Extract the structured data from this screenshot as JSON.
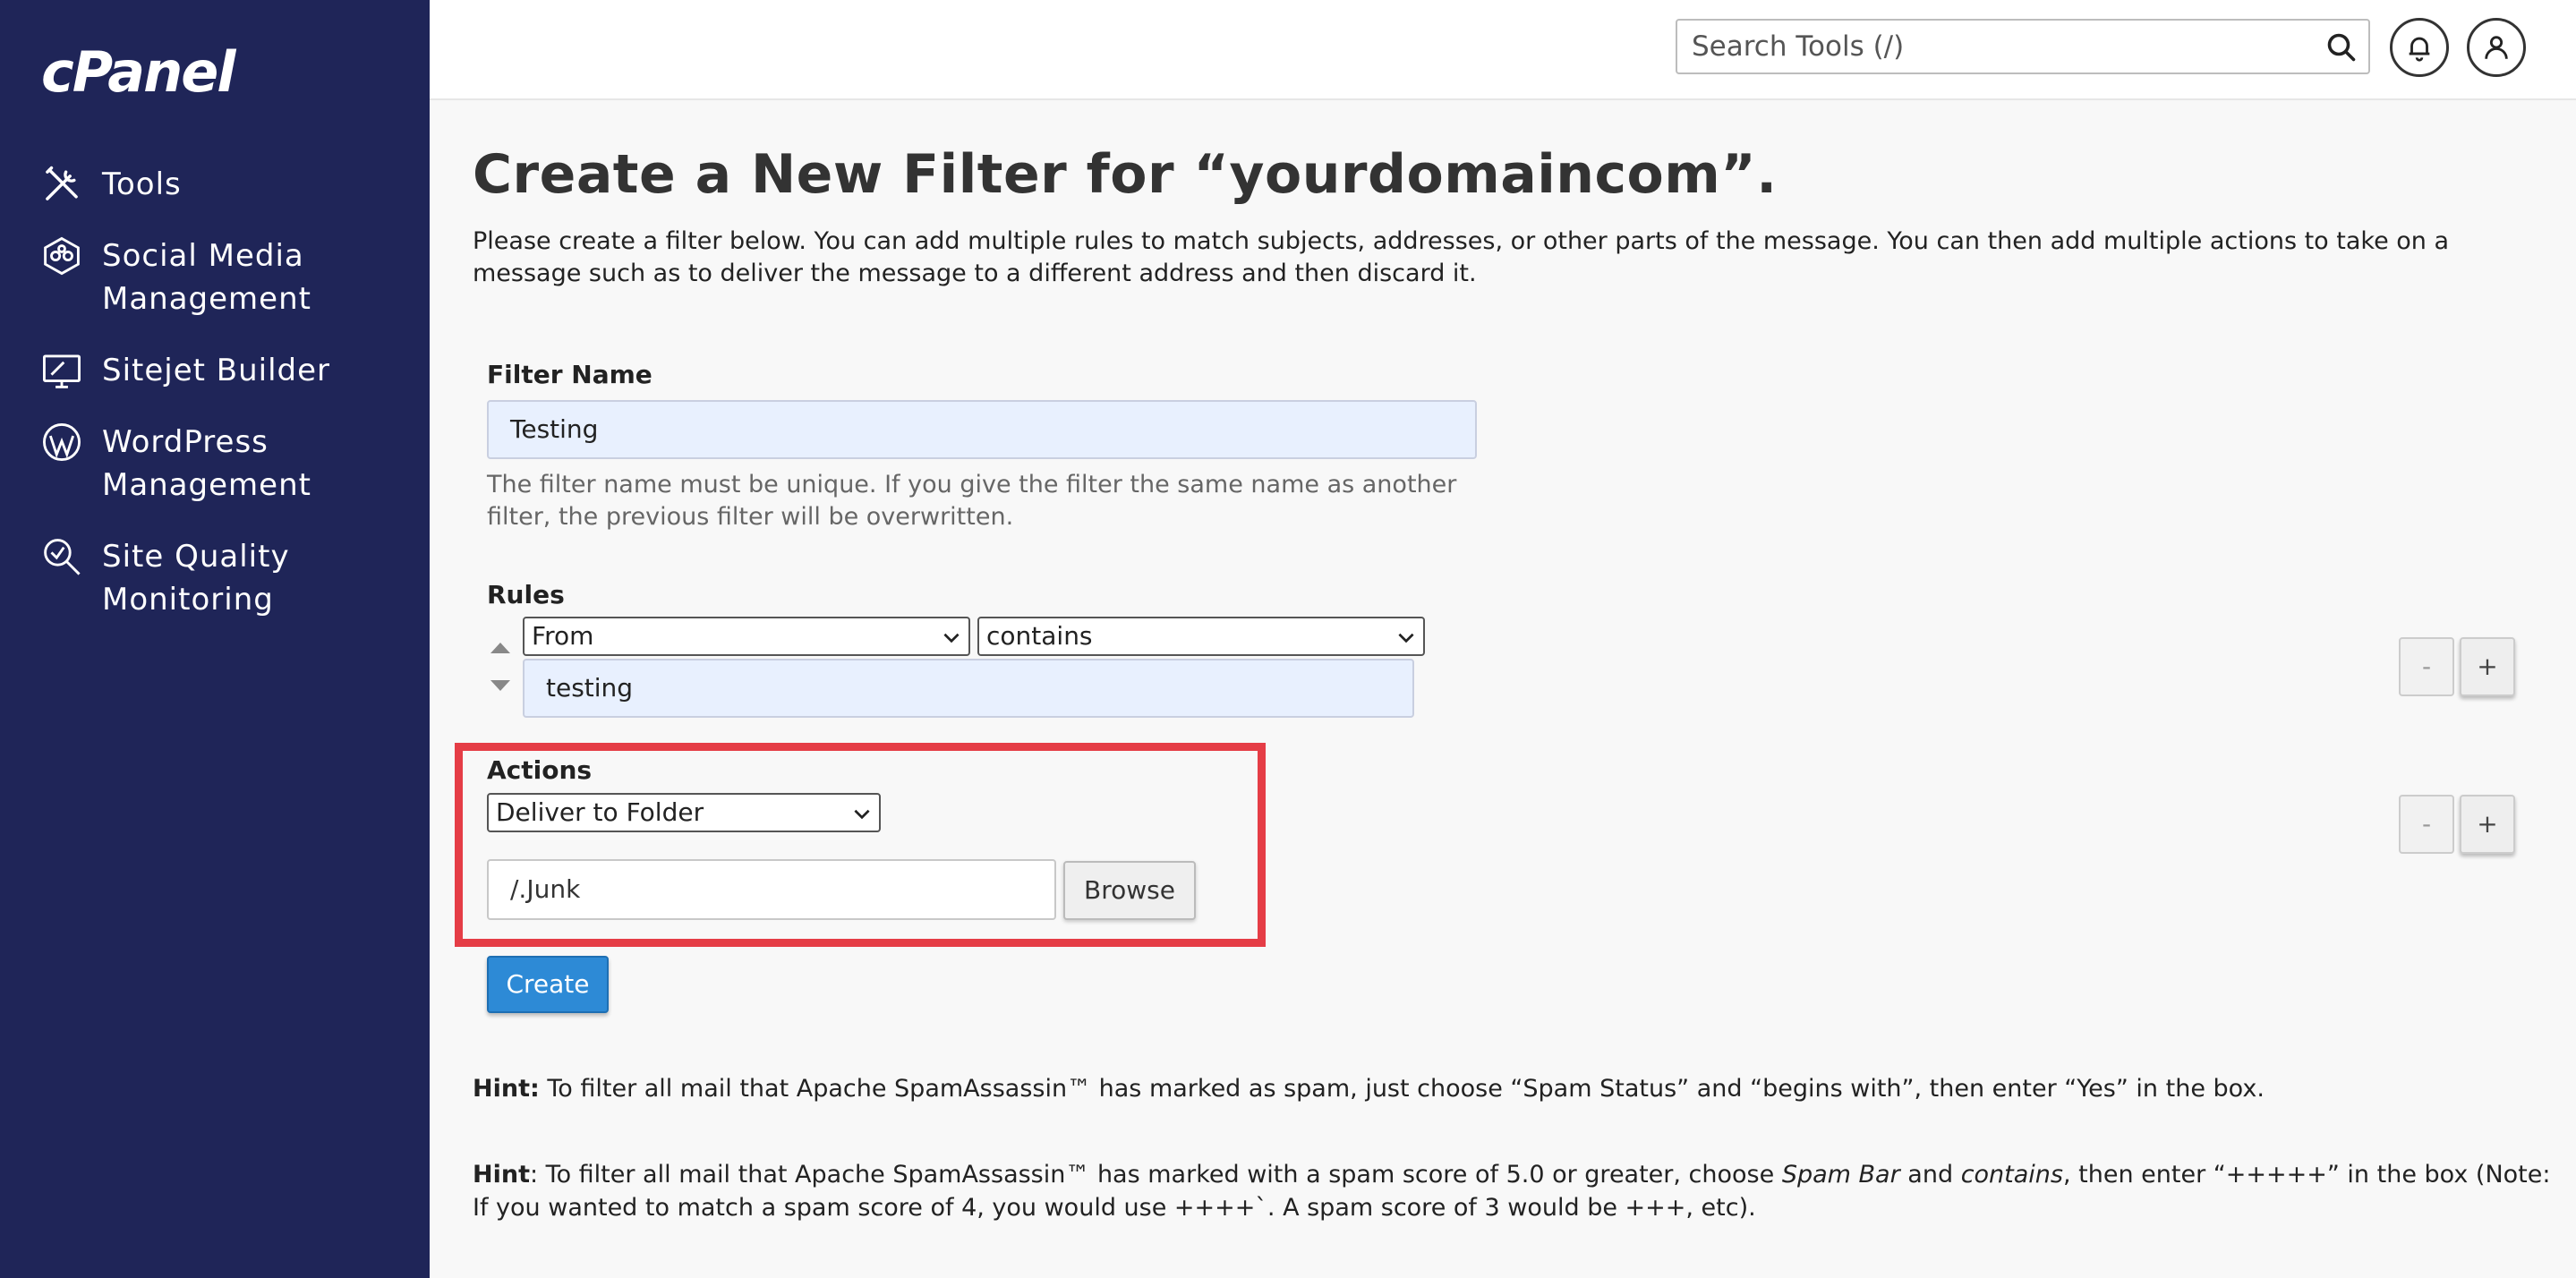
{
  "sidebar": {
    "logo": "cPanel",
    "items": [
      {
        "label": "Tools",
        "icon": "tools-icon"
      },
      {
        "label": "Social Media Management",
        "icon": "social-media-icon"
      },
      {
        "label": "Sitejet Builder",
        "icon": "sitejet-icon"
      },
      {
        "label": "WordPress Management",
        "icon": "wordpress-icon"
      },
      {
        "label": "Site Quality Monitoring",
        "icon": "site-quality-icon"
      }
    ],
    "color": "#1f2558"
  },
  "topbar": {
    "search_placeholder": "Search Tools (/)",
    "icons": [
      "search-icon",
      "bell-icon",
      "user-icon"
    ]
  },
  "main": {
    "title": "Create a New Filter for “yourdomaincom”.",
    "intro": "Please create a filter below. You can add multiple rules to match subjects, addresses, or other parts of the message. You can then add multiple actions to take on a message such as to deliver the message to a different address and then discard it.",
    "filter_name": {
      "label": "Filter Name",
      "value": "Testing",
      "help": "The filter name must be unique. If you give the filter the same name as another filter, the previous filter will be overwritten."
    },
    "rules": {
      "label": "Rules",
      "field_select": "From",
      "operator_select": "contains",
      "value": "testing",
      "minus_label": "-",
      "plus_label": "+"
    },
    "actions": {
      "label": "Actions",
      "action_select": "Deliver to Folder",
      "folder_value": "/.Junk",
      "browse_label": "Browse",
      "minus_label": "-",
      "plus_label": "+"
    },
    "create_label": "Create",
    "hints": [
      {
        "prefix": "Hint:",
        "text": " To filter all mail that Apache SpamAssassin™ has marked as spam, just choose “Spam Status” and “begins with”, then enter “Yes” in the box."
      },
      {
        "prefix": "Hint",
        "t1": ": To filter all mail that Apache SpamAssassin™ has marked with a spam score of 5.0 or greater, choose ",
        "i1": "Spam Bar",
        "t2": " and ",
        "i2": "contains",
        "t3": ", then enter “+++++” in the box (Note: If you wanted to match a spam score of 4, you would use ++++`. A spam score of 3 would be +++, etc)."
      }
    ]
  },
  "colors": {
    "accent_blue": "#2d8ad6",
    "highlight_red": "#e53d46",
    "input_fill": "#e8f0fe"
  }
}
